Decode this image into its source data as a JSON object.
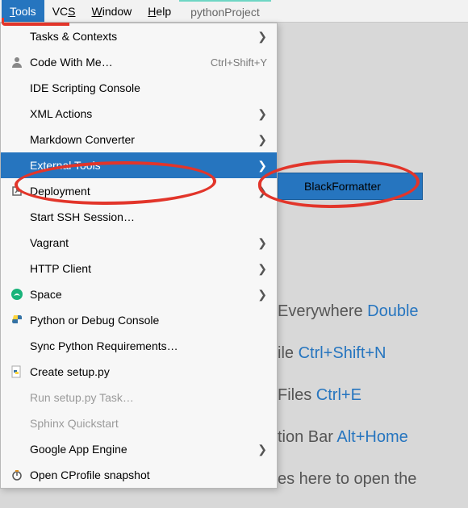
{
  "menubar": {
    "tools": "Tools",
    "vcs": "VCS",
    "window": "Window",
    "help": "Help",
    "project": "pythonProject"
  },
  "menu": {
    "tasks": "Tasks & Contexts",
    "codewithme": "Code With Me…",
    "codewithme_shortcut": "Ctrl+Shift+Y",
    "scripting": "IDE Scripting Console",
    "xml": "XML Actions",
    "markdown": "Markdown Converter",
    "external": "External Tools",
    "deployment": "Deployment",
    "ssh": "Start SSH Session…",
    "vagrant": "Vagrant",
    "httpclient": "HTTP Client",
    "space": "Space",
    "pydebug": "Python or Debug Console",
    "syncreq": "Sync Python Requirements…",
    "createsetup": "Create setup.py",
    "runsetup": "Run setup.py Task…",
    "sphinx": "Sphinx Quickstart",
    "gae": "Google App Engine",
    "cprofile": "Open CProfile snapshot"
  },
  "submenu": {
    "black": "BlackFormatter"
  },
  "hints": {
    "h1a": "Everywhere ",
    "h1b": "Double",
    "h2a": "ile ",
    "h2b": "Ctrl+Shift+N",
    "h3a": " Files ",
    "h3b": "Ctrl+E",
    "h4a": "tion Bar ",
    "h4b": "Alt+Home",
    "h5": "es here to open the"
  },
  "arrow": "❯"
}
